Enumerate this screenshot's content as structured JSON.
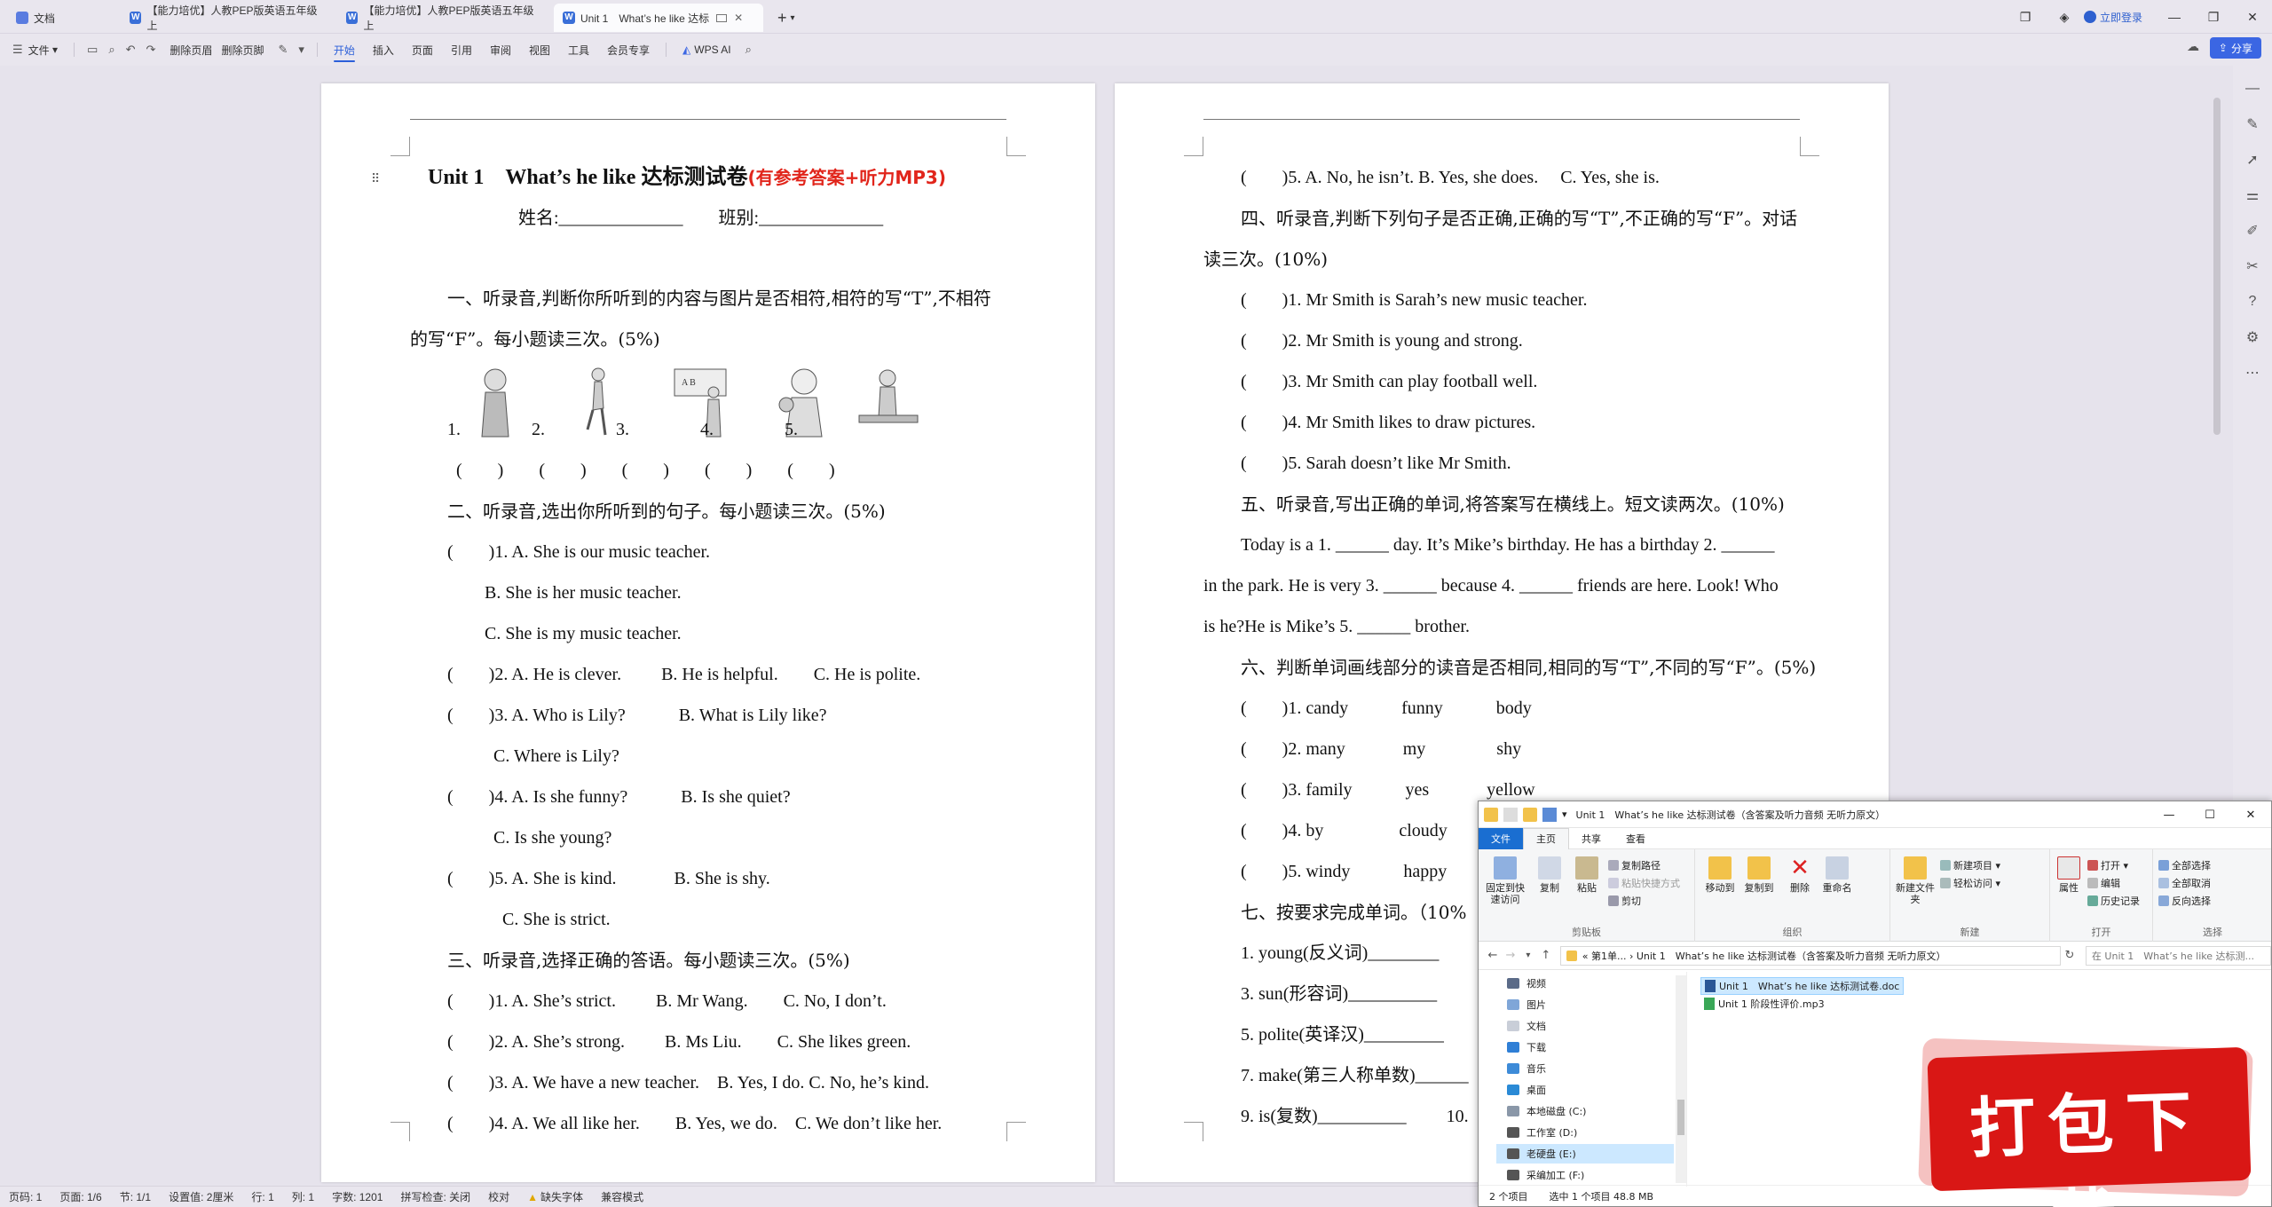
{
  "tabs": [
    {
      "label": "文档",
      "active": false
    },
    {
      "label": "【能力培优】人教PEP版英语五年级上",
      "active": false
    },
    {
      "label": "【能力培优】人教PEP版英语五年级上",
      "active": false
    },
    {
      "label": "Unit 1　What’s he like 达标",
      "active": true
    }
  ],
  "titlebar": {
    "new_tab": "+",
    "login": "立即登录"
  },
  "menu": {
    "file": "文件",
    "delete_header": "删除页眉",
    "delete_footer": "删除页脚",
    "items": [
      "开始",
      "插入",
      "页面",
      "引用",
      "审阅",
      "视图",
      "工具",
      "会员专享"
    ],
    "active": "开始",
    "ai": "WPS AI",
    "share": "分享"
  },
  "page1": {
    "title_main": "Unit 1　What’s he like  达标测试卷",
    "title_red": "(有参考答案+听力MP3)",
    "name_line": "姓名:______________　　班别:______________",
    "lines": [
      "一、听录音,判断你所听到的内容与图片是否相符,相符的写“T”,不相符",
      "的写“F”。每小题读三次。(5%)",
      "1.　　　　2.　　　　3.　　　　4.　　　　5.",
      "(　　)　　(　　)　　(　　)　　(　　)　　(　　)",
      "二、听录音,选出你所听到的句子。每小题读三次。(5%)",
      "(　　)1. A. She is our music teacher.",
      "B. She is her music teacher.",
      "C. She is my music teacher.",
      "(　　)2. A. He is clever.　　 B. He is helpful.　　C. He is polite.",
      "(　　)3. A. Who is Lily?　　　B. What is Lily like?",
      "C. Where is Lily?",
      "(　　)4. A. Is she funny?　　　B. Is she quiet?",
      "C. Is she young?",
      "(　　)5. A. She is kind.　　　 B. She is shy.",
      "C. She is strict.",
      "三、听录音,选择正确的答语。每小题读三次。(5%)",
      "(　　)1. A. She’s strict.　　 B. Mr Wang.　　C. No, I don’t.",
      "(　　)2. A. She’s strong.　　 B. Ms Liu.　　C. She likes green.",
      "(　　)3. A. We have a new teacher.　B. Yes, I do. C. No, he’s kind.",
      "(　　)4. A. We all like her.　　B. Yes, we do.　C. We don’t like her."
    ]
  },
  "page2": {
    "lines": [
      "(　　)5. A. No, he isn’t. B. Yes, she does.　 C. Yes, she is.",
      "四、听录音,判断下列句子是否正确,正确的写“T”,不正确的写“F”。对话",
      "读三次。(10%)",
      "(　　)1. Mr Smith is Sarah’s new music teacher.",
      "(　　)2. Mr Smith is young and strong.",
      "(　　)3. Mr Smith can play football well.",
      "(　　)4. Mr Smith likes to draw pictures.",
      "(　　)5. Sarah doesn’t like Mr Smith.",
      "五、听录音,写出正确的单词,将答案写在横线上。短文读两次。(10%)",
      "Today is a 1. ______ day. It’s Mike’s birthday. He has a birthday 2. ______",
      "in the park. He is very 3. ______ because 4. ______ friends are here. Look! Who",
      "is he?He is Mike’s 5. ______ brother.",
      "六、判断单词画线部分的读音是否相同,相同的写“T”,不同的写“F”。(5%)",
      "(　　)1. candy　　　funny　　　body",
      "(　　)2. many　　　 my　　　　shy",
      "(　　)3. family　　　yes　　　 yellow",
      "(　　)4. by　　　　 cloudy",
      "(　　)5. windy　　　happy",
      "七、按要求完成单词。（10%",
      "1. young(反义词)________",
      "3. sun(形容词)__________",
      "5. polite(英译汉)_________",
      "7. make(第三人称单数)______",
      "9. is(复数)__________　　 10."
    ]
  },
  "statusbar": [
    "页码: 1",
    "页面: 1/6",
    "节: 1/1",
    "设置值: 2厘米",
    "行: 1",
    "列: 1",
    "字数: 1201",
    "拼写检查: 关闭",
    "校对",
    "缺失字体",
    "兼容模式"
  ],
  "explorer": {
    "title": "Unit 1　What’s he like 达标测试卷（含答案及听力音频 无听力原文）",
    "tabs": [
      "文件",
      "主页",
      "共享",
      "查看"
    ],
    "ribbon": {
      "pin": "固定到快速访问",
      "copy": "复制",
      "paste": "粘贴",
      "copy_path": "复制路径",
      "paste_shortcut": "粘贴快捷方式",
      "cut": "剪切",
      "clipboard": "剪贴板",
      "move_to": "移动到",
      "copy_to": "复制到",
      "delete": "删除",
      "rename": "重命名",
      "organize": "组织",
      "new_folder": "新建文件夹",
      "new_item": "新建项目",
      "easy_access": "轻松访问",
      "new": "新建",
      "properties": "属性",
      "open": "打开",
      "edit": "编辑",
      "history": "历史记录",
      "open_group": "打开",
      "select_all": "全部选择",
      "select_none": "全部取消",
      "invert": "反向选择",
      "select_group": "选择"
    },
    "address": "«  第1单...  ›  Unit 1　What’s he like 达标测试卷（含答案及听力音频 无听力原文）",
    "search": "在 Unit 1　What’s he like 达标测...",
    "tree": [
      "视频",
      "图片",
      "文档",
      "下载",
      "音乐",
      "桌面",
      "本地磁盘 (C:)",
      "工作室 (D:)",
      "老硬盘 (E:)",
      "采编加工 (F:)"
    ],
    "files": [
      {
        "name": "Unit 1　What’s he like 达标测试卷.doc",
        "type": "word",
        "selected": true
      },
      {
        "name": "Unit 1 阶段性评价.mp3",
        "type": "mp3",
        "selected": false
      }
    ],
    "status": [
      "2 个项目",
      "选中 1 个项目  48.8 MB"
    ]
  },
  "badge": "打包下载"
}
